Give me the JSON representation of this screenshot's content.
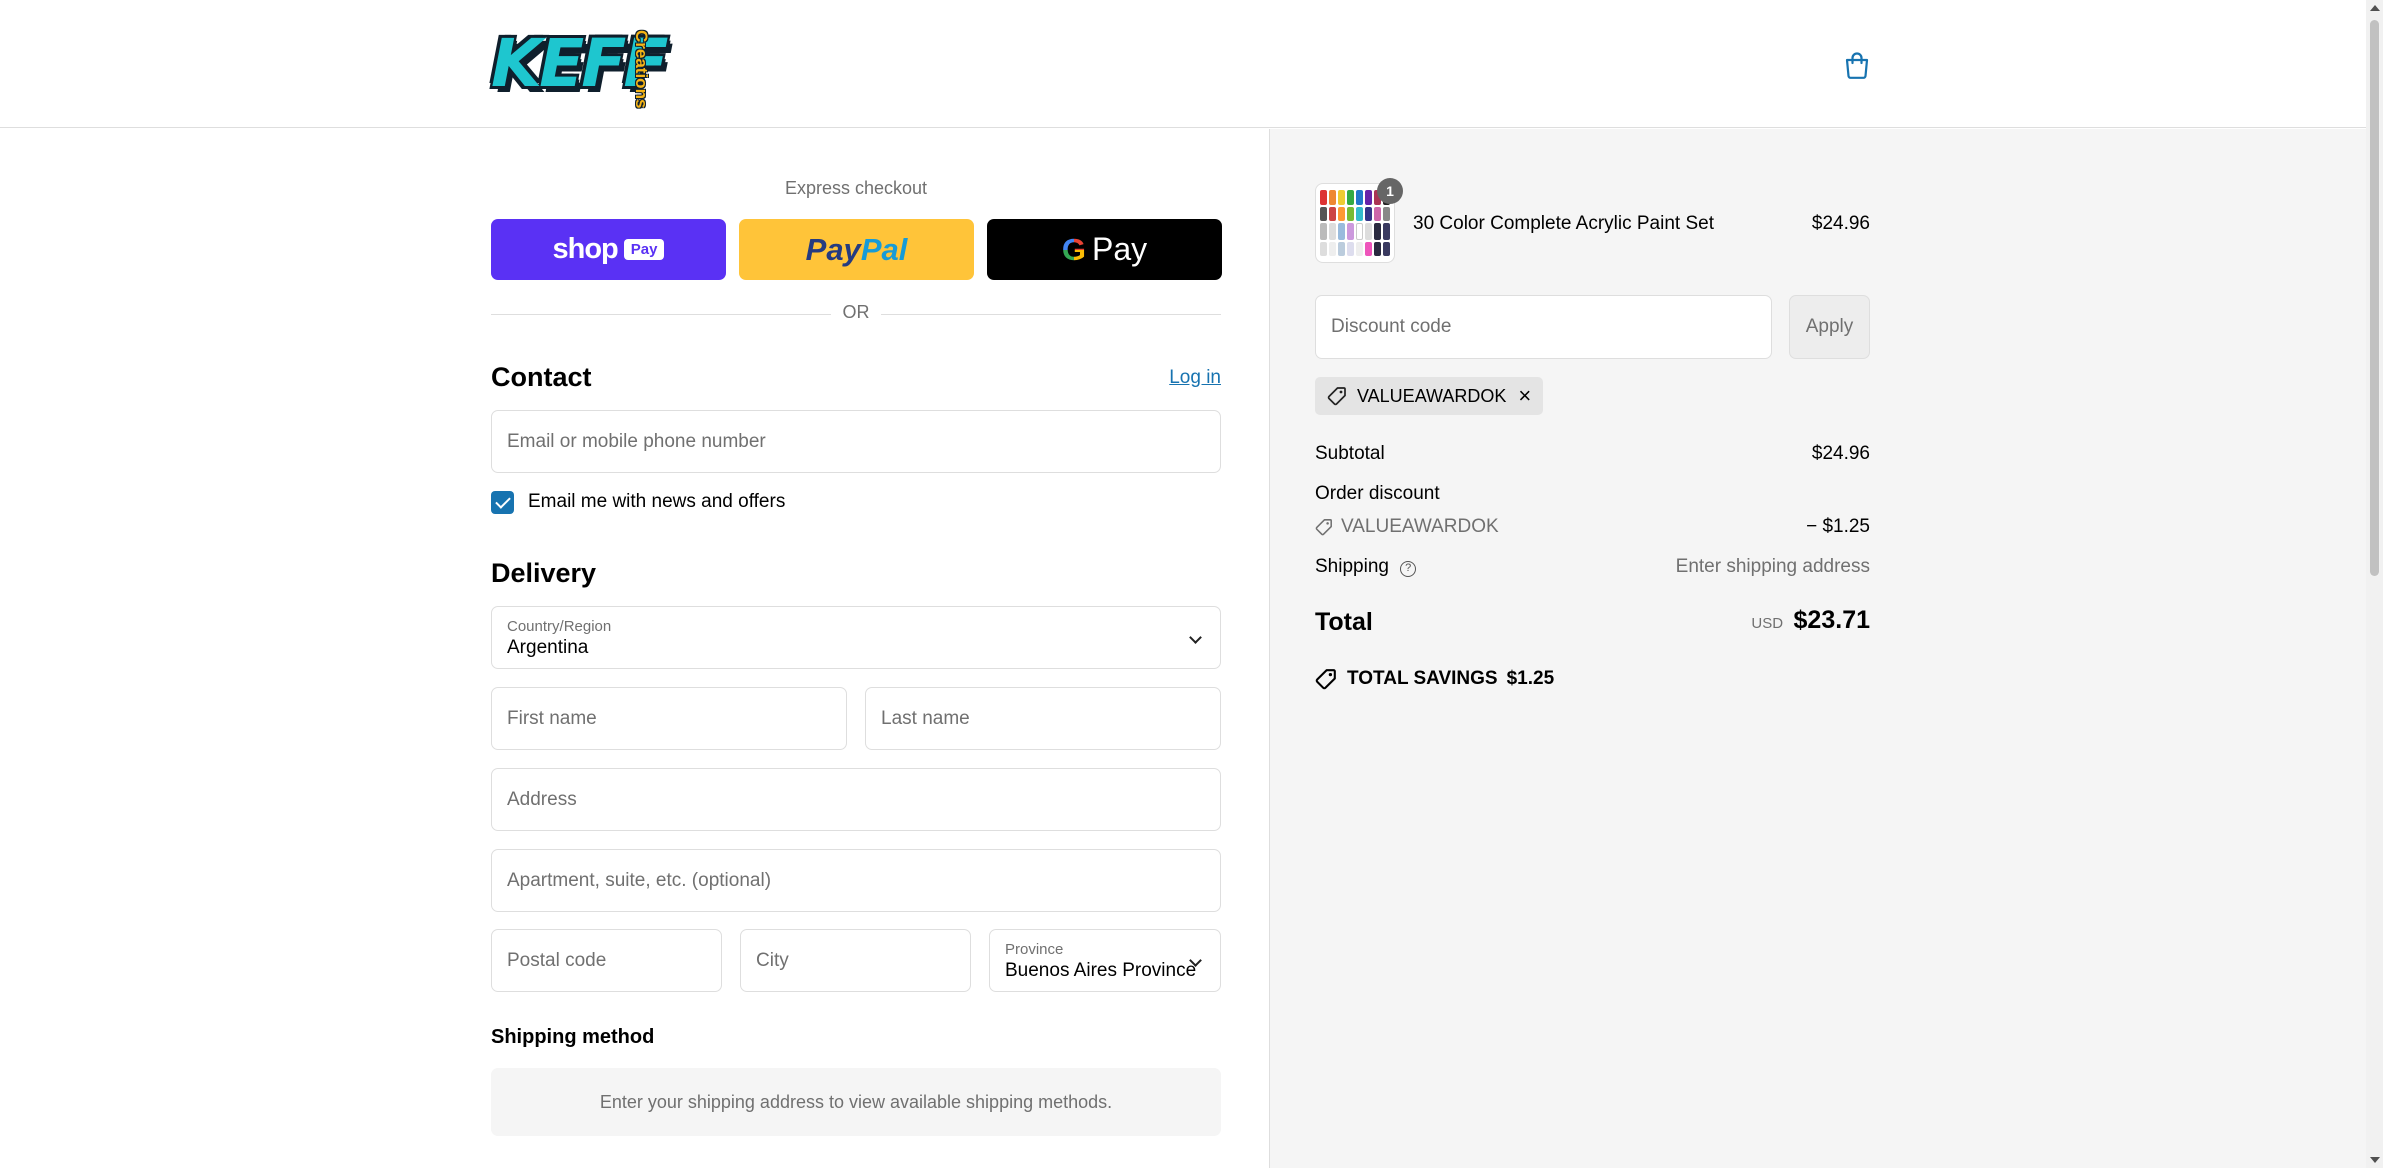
{
  "header": {
    "logo_text": "KEFF",
    "logo_subtext": "Creations",
    "cart_icon": "shopping-bag-icon"
  },
  "express": {
    "label": "Express checkout",
    "shop_pay": {
      "word": "shop",
      "badge": "Pay"
    },
    "paypal": {
      "part1": "Pay",
      "part2": "Pal"
    },
    "gpay": {
      "g": "G",
      "label": "Pay"
    },
    "or_label": "OR"
  },
  "contact": {
    "title": "Contact",
    "login_link": "Log in",
    "email_placeholder": "Email or mobile phone number",
    "news_checkbox_label": "Email me with news and offers",
    "news_checked": true
  },
  "delivery": {
    "title": "Delivery",
    "country_label": "Country/Region",
    "country_value": "Argentina",
    "first_name_placeholder": "First name",
    "last_name_placeholder": "Last name",
    "address_placeholder": "Address",
    "apartment_placeholder": "Apartment, suite, etc. (optional)",
    "postal_placeholder": "Postal code",
    "city_placeholder": "City",
    "province_label": "Province",
    "province_value": "Buenos Aires Province"
  },
  "shipping_method": {
    "title": "Shipping method",
    "note": "Enter your shipping address to view available shipping methods."
  },
  "summary": {
    "product": {
      "name": "30 Color Complete Acrylic Paint Set",
      "price": "$24.96",
      "quantity": "1"
    },
    "discount_placeholder": "Discount code",
    "apply_label": "Apply",
    "applied_code": "VALUEAWARDOK",
    "subtotal_label": "Subtotal",
    "subtotal_value": "$24.96",
    "order_discount_label": "Order discount",
    "order_discount_code": "VALUEAWARDOK",
    "order_discount_value": "− $1.25",
    "shipping_label": "Shipping",
    "shipping_value": "Enter shipping address",
    "total_label": "Total",
    "total_currency": "USD",
    "total_value": "$23.71",
    "savings_label": "TOTAL SAVINGS",
    "savings_value": "$1.25"
  },
  "colors": {
    "accent": "#1773b0",
    "shop_pay": "#5a31f4",
    "paypal": "#ffc439",
    "summary_bg": "#f5f5f5"
  }
}
